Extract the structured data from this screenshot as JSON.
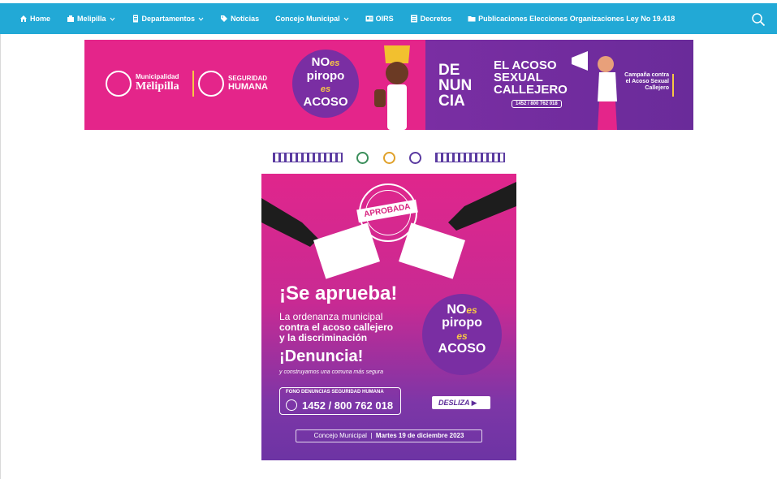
{
  "nav": {
    "items": [
      {
        "label": "Home",
        "icon": "home-icon"
      },
      {
        "label": "Melipilla",
        "icon": "building-icon",
        "dropdown": true
      },
      {
        "label": "Departamentos",
        "icon": "document-icon",
        "dropdown": true
      },
      {
        "label": "Noticias",
        "icon": "tag-icon"
      },
      {
        "label": "Concejo Municipal",
        "icon": "",
        "dropdown": true
      },
      {
        "label": "OIRS",
        "icon": "id-card-icon"
      },
      {
        "label": "Decretos",
        "icon": "list-icon"
      },
      {
        "label": "Publicaciones Elecciones Organizaciones Ley No 19.418",
        "icon": "folder-icon"
      }
    ],
    "search_icon": "search-icon"
  },
  "banner": {
    "logo1_small": "Municipalidad",
    "logo1_name": "Mëlipilla",
    "logo2_line1": "SEGURIDAD",
    "logo2_line2": "HUMANA",
    "speech_no": "NO",
    "speech_es": "es",
    "speech_piropo": "piropo",
    "speech_es2": "es",
    "speech_acoso": "ACOSO",
    "denuncia_1": "DE",
    "denuncia_2": "NUN",
    "denuncia_3": "CIA",
    "acoso_1": "EL ACOSO",
    "acoso_2": "SEXUAL",
    "acoso_3": "CALLEJERO",
    "phone": "1452 / 800 762 018",
    "campana": "Campaña contra el Acoso Sexual Callejero",
    "colors": {
      "pink": "#e4258a",
      "purple": "#7a2ea3",
      "yellow": "#f7c843"
    }
  },
  "poster": {
    "stamp": "APROBADA",
    "title": "¡Se aprueba!",
    "sub_1": "La ordenanza municipal",
    "sub_2": "contra el acoso callejero",
    "sub_3": "y la discriminación",
    "denuncia": "¡Denuncia!",
    "tagline": "y construyamos una comuna más segura",
    "bubble_no": "NO",
    "bubble_es": "es",
    "bubble_piropo": "piropo",
    "bubble_es2": "es",
    "bubble_acoso": "ACOSO",
    "fono_label": "FONO DENUNCIAS SEGURIDAD HUMANA",
    "fono_num": "1452 / 800 762 018",
    "desliza": "DESLIZA ▶",
    "bottom_left": "Concejo Municipal",
    "bottom_right": "Martes 19 de diciembre 2023"
  }
}
